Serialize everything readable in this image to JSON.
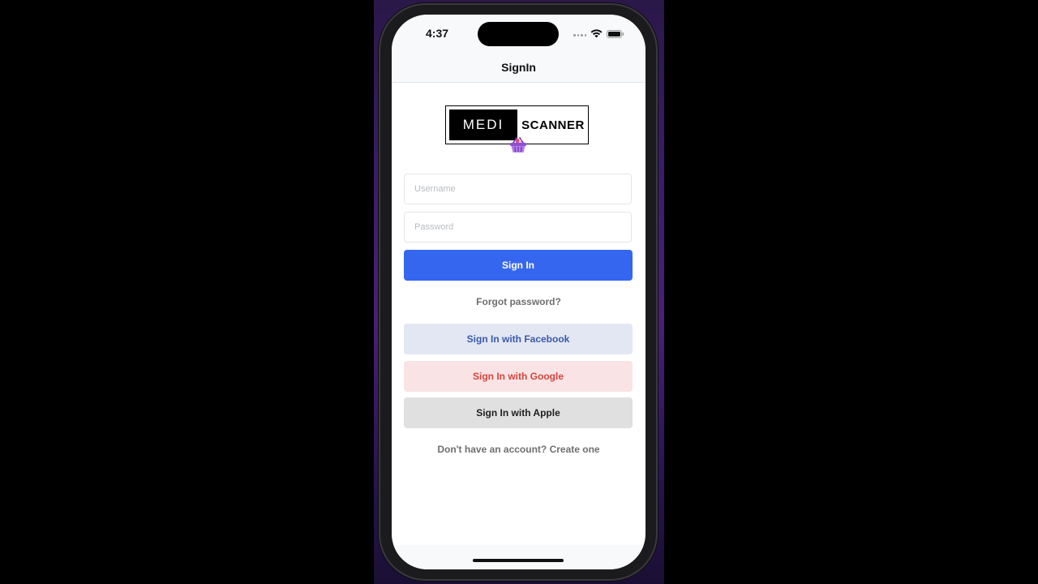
{
  "status_bar": {
    "time": "4:37",
    "icons": [
      "signal-dots-icon",
      "wifi-icon",
      "battery-icon"
    ]
  },
  "nav": {
    "title": "SignIn"
  },
  "logo": {
    "left_text": "MEDI",
    "right_text": "SCANNER",
    "icon": "basket-icon"
  },
  "form": {
    "username_placeholder": "Username",
    "username_value": "",
    "password_placeholder": "Password",
    "password_value": "",
    "sign_in_label": "Sign In",
    "forgot_password_label": "Forgot password?"
  },
  "social": {
    "facebook_label": "Sign In with Facebook",
    "google_label": "Sign In with Google",
    "apple_label": "Sign In with Apple"
  },
  "footer": {
    "create_account_label": "Don't have an account? Create one"
  },
  "colors": {
    "primary": "#3566f0",
    "facebook_bg": "#e3e7f4",
    "facebook_text": "#3a5aa8",
    "google_bg": "#f9e3e5",
    "google_text": "#d6453d",
    "apple_bg": "#e0e0e0",
    "logo_accent": "#8e4fd1"
  }
}
